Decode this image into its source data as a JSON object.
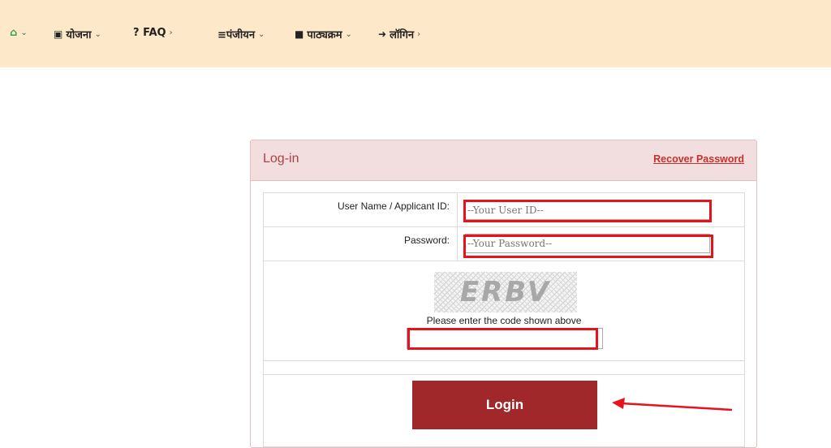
{
  "nav": {
    "home_icon": "home-icon",
    "items": [
      {
        "label": "योजना",
        "icon": "cube-icon"
      },
      {
        "label": "? FAQ",
        "icon": ""
      },
      {
        "label": "≡पंजीयन",
        "icon": ""
      },
      {
        "label": "पाठ्यक्रम",
        "icon": "book-icon"
      },
      {
        "label": "लॉगिन",
        "icon": "sign-in-icon"
      }
    ]
  },
  "panel": {
    "title": "Log-in",
    "recover_link": "Recover Password"
  },
  "form": {
    "username_label": "User Name / Applicant ID:",
    "username_placeholder": "--Your User ID--",
    "password_label": "Password:",
    "password_placeholder": "--Your Password--",
    "captcha_code": "ERBV",
    "captcha_hint": "Please enter the code shown above",
    "captcha_value": "",
    "login_label": "Login"
  },
  "colors": {
    "nav_bg": "#fde9c9",
    "panel_head_bg": "#f2dedf",
    "title_color": "#a94442",
    "button_bg": "#a0282a",
    "highlight": "#e8121a"
  }
}
